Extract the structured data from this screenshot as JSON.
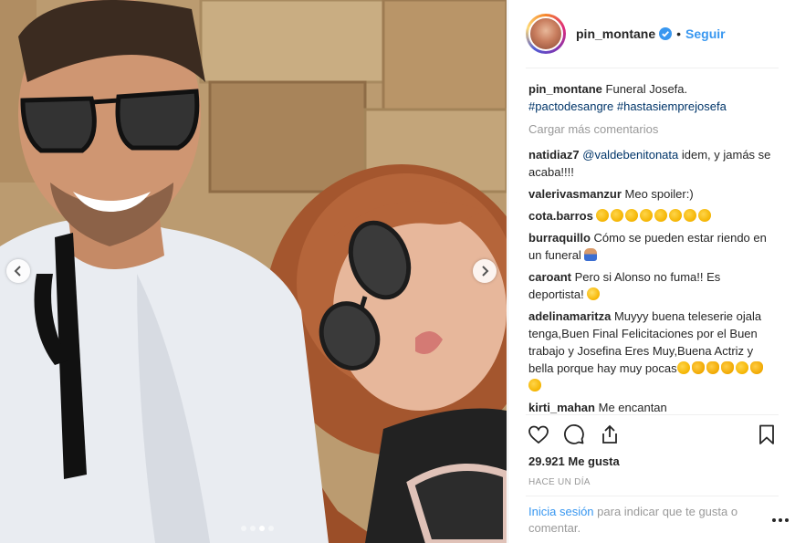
{
  "post": {
    "author": "pin_montane",
    "follow_label": "Seguir",
    "separator": "•",
    "caption": {
      "user": "pin_montane",
      "text": "Funeral Josefa.",
      "hashtags": "#pactodesangre #hastasiemprejosefa"
    },
    "load_more_label": "Cargar más comentarios",
    "comments": [
      {
        "user": "natidiaz7",
        "mention": "@valdebenitonata",
        "text": " idem, y jamás se acaba!!!!"
      },
      {
        "user": "valerivasmanzur",
        "text": "Meo spoiler:)"
      },
      {
        "user": "cota.barros",
        "text": ""
      },
      {
        "user": "burraquillo",
        "text": "Cómo se pueden estar riendo en un funeral"
      },
      {
        "user": "caroant",
        "text": "Pero si Alonso no fuma!! Es deportista!"
      },
      {
        "user": "adelinamaritza",
        "text": "Muyyy buena teleserie ojala tenga,Buen Final Felicitaciones por el Buen trabajo y Josefina Eres Muy,Buena Actriz y bella porque hay muy pocas"
      },
      {
        "user": "kirti_mahan",
        "text": "Me encantan"
      }
    ],
    "likes": "29.921 Me gusta",
    "time": "Hace un día",
    "login": {
      "link": "Inicia sesión",
      "text": " para indicar que te gusta o comentar."
    }
  },
  "carousel": {
    "count": 4,
    "active": 2
  },
  "icons": {
    "verified": "verified-badge-icon",
    "like": "heart-icon",
    "comment": "comment-bubble-icon",
    "share": "share-icon",
    "save": "bookmark-icon",
    "more": "more-options-icon",
    "prev": "chevron-left-icon",
    "next": "chevron-right-icon",
    "emoji_clap": "clapping-hands-icon",
    "emoji_raised": "raised-hands-icon",
    "emoji_laugh": "laughing-face-icon",
    "emoji_shrug": "person-shrugging-icon"
  },
  "colors": {
    "link": "#3897f0",
    "hashtag": "#003569",
    "muted": "#999999",
    "text": "#262626",
    "divider": "#efefef"
  }
}
